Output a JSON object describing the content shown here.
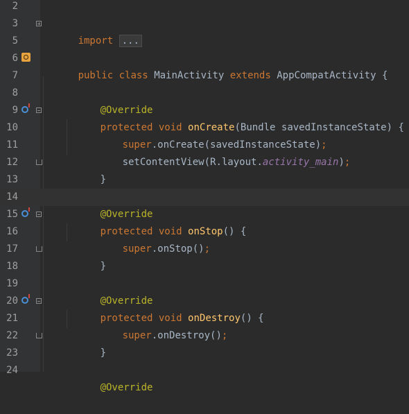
{
  "line_numbers": [
    "2",
    "3",
    "5",
    "6",
    "7",
    "8",
    "9",
    "10",
    "11",
    "12",
    "13",
    "14",
    "15",
    "16",
    "17",
    "18",
    "19",
    "20",
    "21",
    "22",
    "23",
    "24"
  ],
  "lines": {
    "l3_import": "import",
    "l3_dots": "...",
    "l6_public": "public",
    "l6_class": "class",
    "l6_name": "MainActivity",
    "l6_extends": "extends",
    "l6_parent": "AppCompatActivity",
    "l6_brace": "{",
    "override": "@Override",
    "protected": "protected",
    "void": "void",
    "onCreate": "onCreate",
    "onCreate_params": "(Bundle savedInstanceState) {",
    "super": "super",
    "dot_onCreate": ".onCreate(savedInstanceState)",
    "semicolon": ";",
    "setContentView": "setContentView(R.layout.",
    "activity_main": "activity_main",
    "close_paren": ")",
    "close_brace": "}",
    "onStop": "onStop",
    "empty_parens_brace": "() {",
    "dot_onStop": ".onStop()",
    "onDestroy": "onDestroy",
    "dot_onDestroy": ".onDestroy()"
  },
  "colors": {
    "background": "#2b2b2b",
    "keyword": "#cc7832",
    "function": "#ffc66d",
    "annotation": "#bbb529",
    "field": "#9876aa",
    "text": "#a9b7c6"
  }
}
